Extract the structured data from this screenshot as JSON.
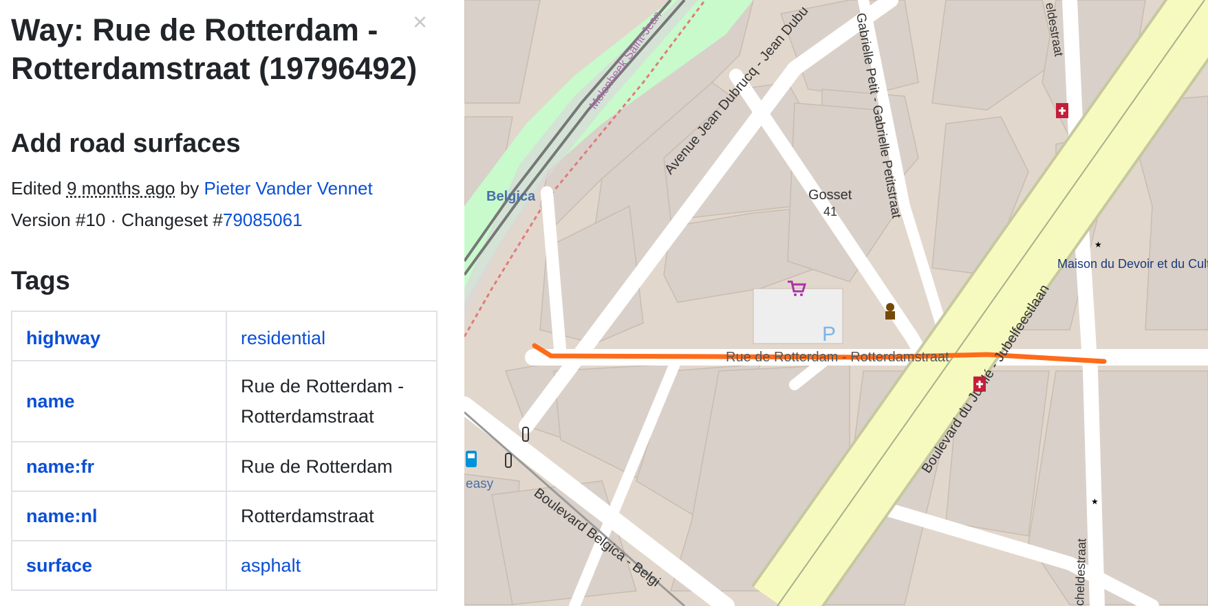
{
  "sidebar": {
    "title": "Way: Rue de Rotterdam - Rotterdamstraat (19796492)",
    "close_symbol": "×",
    "changeset_comment": "Add road surfaces",
    "edited_prefix": "Edited",
    "edited_time": "9 months ago",
    "by_word": "by",
    "author": "Pieter Vander Vennet",
    "version_text": "Version #10 · Changeset #",
    "changeset_id": "79085061",
    "tags_heading": "Tags",
    "tags": [
      {
        "key": "highway",
        "value": "residential",
        "value_is_link": true
      },
      {
        "key": "name",
        "value": "Rue de Rotterdam - Rotterdamstraat",
        "value_is_link": false
      },
      {
        "key": "name:fr",
        "value": "Rue de Rotterdam",
        "value_is_link": false
      },
      {
        "key": "name:nl",
        "value": "Rotterdamstraat",
        "value_is_link": false
      },
      {
        "key": "surface",
        "value": "asphalt",
        "value_is_link": true
      }
    ]
  },
  "map": {
    "colors": {
      "building": "#d9d0c9",
      "landuse": "#e2d7cc",
      "road": "#ffffff",
      "primary": "#f7fabf",
      "park": "#c8facc",
      "highlight": "#ff6b1a",
      "rail": "#777777",
      "label": "#333333"
    },
    "labels": {
      "street_main": "Rue de Rotterdam - Rotterdamstraat",
      "avenue": "Avenue Jean Dubrucq - Jean Dubu",
      "boulevard_jubile": "Boulevard du Jubilé - Jubelfeestlaan",
      "boulevard_belgica": "Boulevard Belgica - Belgi",
      "gabrielle": "Gabrielle Petit - Gabrielle Petitstraat",
      "station": "Belgica",
      "gosset": "Gosset",
      "gosset_no": "41",
      "maison": "Maison du Devoir et du Culte",
      "molenbeek": "Molenbeek Saint-Jean",
      "easy": "easy",
      "scheldestraat_top": "eldestraat",
      "scheldestraat_bottom": "cheldestraat"
    },
    "icons": [
      "shopping-cart-icon",
      "pharmacy-icon",
      "police-icon",
      "mosque-icon",
      "parking-icon",
      "fuel-icon",
      "traffic-signal-icon"
    ]
  }
}
